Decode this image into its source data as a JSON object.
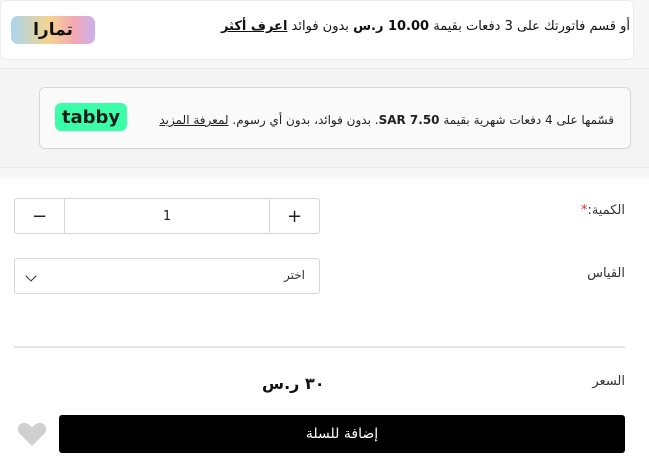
{
  "tamara": {
    "logo_text": "تمارا",
    "text_prefix": "أو قسم فاتورتك على 3 دفعات بقيمة",
    "amount": "10.00 ر.س",
    "text_suffix": "بدون فوائد",
    "learn_more": "اعرف أكثر",
    "logo_gradient": [
      "#a9d5ef",
      "#f4d48f",
      "#f3a8b3",
      "#c9b0ef"
    ]
  },
  "tabby": {
    "logo_text": "tabby",
    "text_prefix": "قسّمها على 4 دفعات شهرية بقيمة",
    "amount": "SAR 7.50",
    "text_suffix": ". بدون فوائد، بدون أي رسوم.",
    "learn_more": "لمعرفة المزيد",
    "logo_color": "#3bffa8"
  },
  "form": {
    "quantity_label": "الكمية:",
    "required_mark": "*",
    "quantity_value": "1",
    "minus": "−",
    "plus": "+",
    "size_label": "القياس",
    "size_selected": "اختر",
    "price_label": "السعر",
    "price_value": "٣٠ ر.س",
    "add_to_cart": "إضافة للسلة"
  },
  "icons": {
    "wishlist": "heart-icon",
    "dropdown": "chevron-down-icon"
  },
  "colors": {
    "required": "#e0302a",
    "cart_button": "#000000",
    "heart": "#cfcfcf"
  }
}
